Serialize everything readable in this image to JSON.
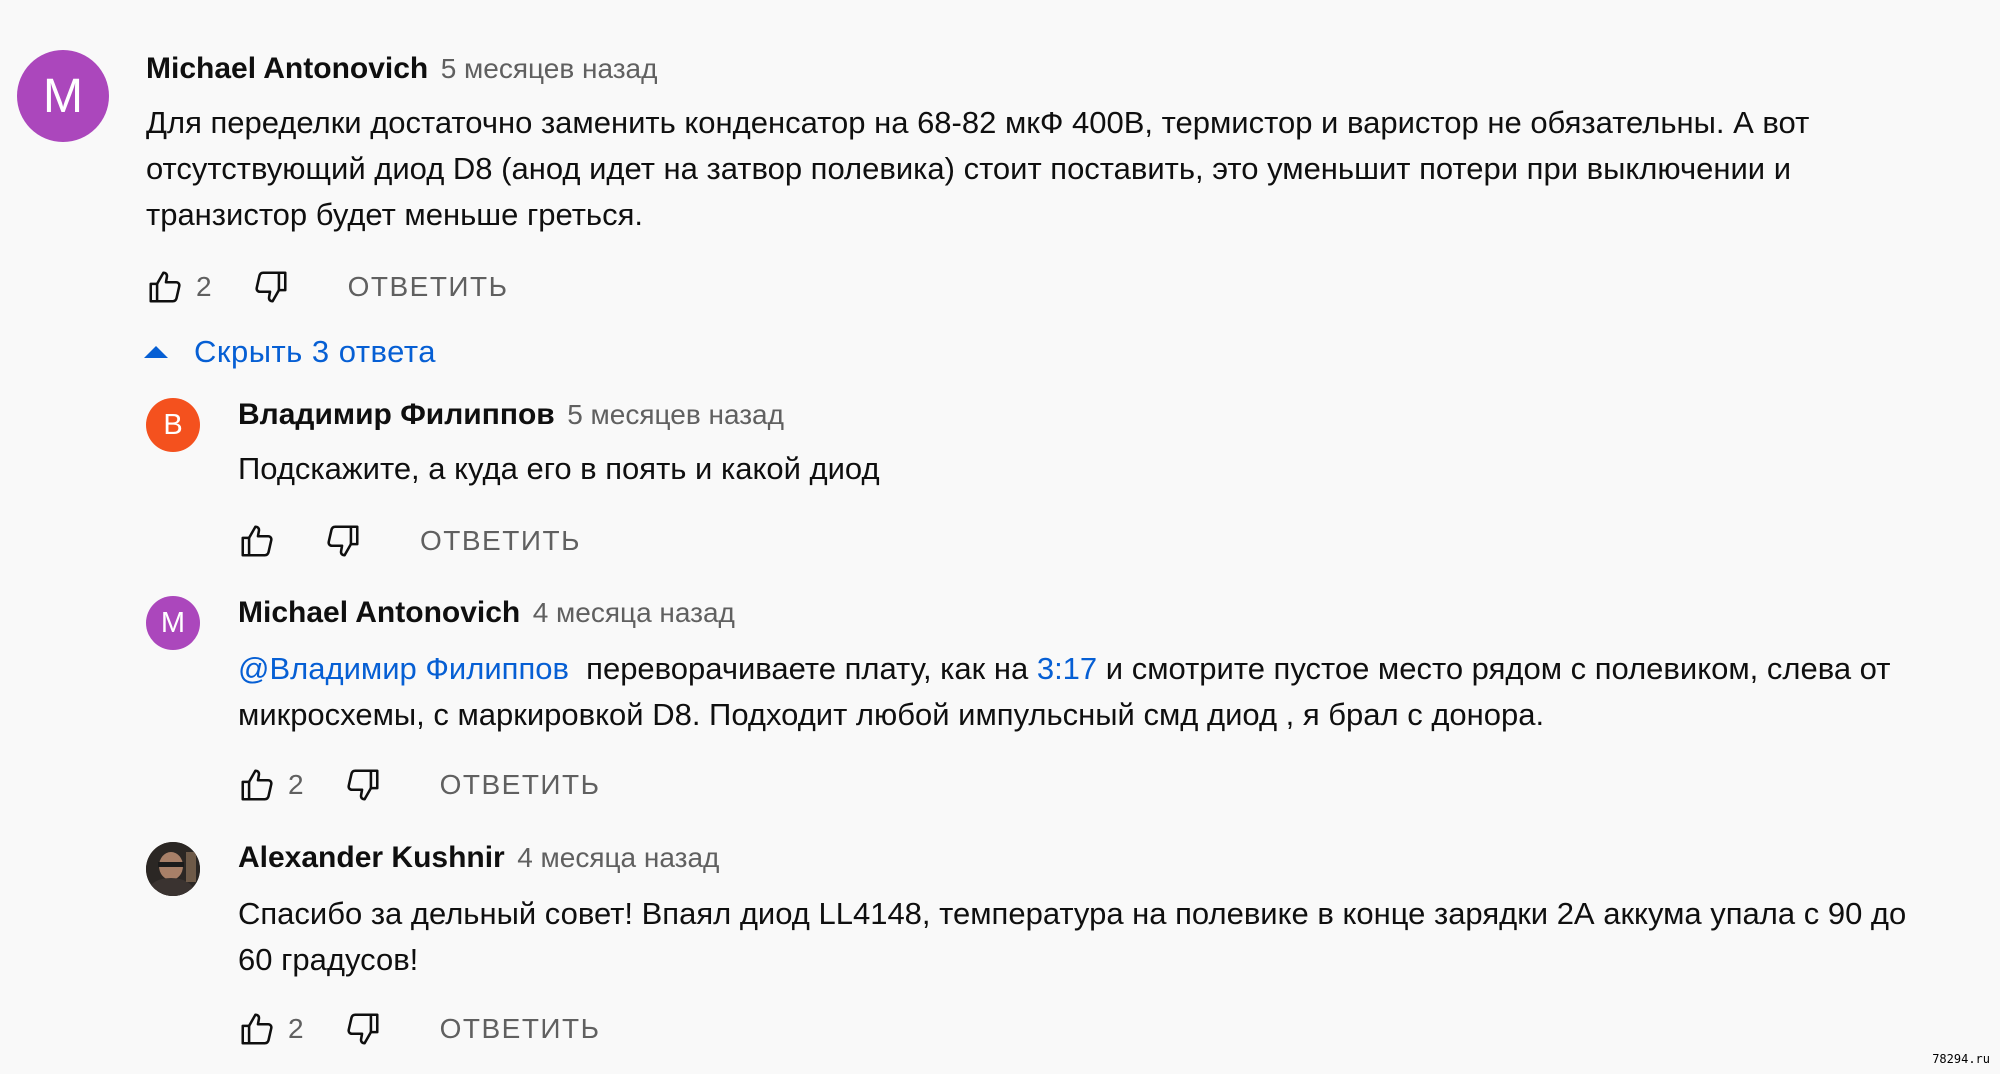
{
  "colors": {
    "background": "#f9f9f9",
    "link": "#065fd4",
    "meta": "#606060",
    "avatar_purple": "#ab47bc",
    "avatar_orange": "#f4511e"
  },
  "icons": {
    "like": "thumb-up-outline-icon",
    "dislike": "thumb-down-outline-icon",
    "collapse": "triangle-up-icon"
  },
  "top_comment": {
    "avatar_letter": "M",
    "author": "Michael Antonovich",
    "time": "5 месяцев назад",
    "text": "Для переделки достаточно заменить конденсатор на 68-82 мкФ 400В, термистор и варистор не обязательны. А вот отсутствующий диод D8 (анод идет на затвор полевика) стоит поставить, это уменьшит потери при выключении и транзистор будет меньше греться.",
    "likes": "2",
    "reply_label": "ОТВЕТИТЬ"
  },
  "replies_toggle": {
    "label": "Скрыть 3 ответа"
  },
  "replies": [
    {
      "avatar_letter": "В",
      "author": "Владимир Филиппов",
      "time": "5 месяцев назад",
      "text": "Подскажите, а куда его в поять и какой диод",
      "likes": "",
      "reply_label": "ОТВЕТИТЬ"
    },
    {
      "avatar_letter": "M",
      "author": "Michael Antonovich",
      "time": "4 месяца назад",
      "mention": "@Владимир Филиппов",
      "text_before": "  переворачиваете плату, как на ",
      "timestamp": "3:17",
      "text_after": " и смотрите пустое место рядом с полевиком, слева от микросхемы, с маркировкой D8. Подходит любой импульсный смд диод , я брал с донора.",
      "likes": "2",
      "reply_label": "ОТВЕТИТЬ"
    },
    {
      "author": "Alexander Kushnir",
      "time": "4 месяца назад",
      "text": "Спасибо за дельный совет! Впаял диод LL4148, температура на полевике в конце зарядки 2А аккума упала с 90 до 60 градусов!",
      "likes": "2",
      "reply_label": "ОТВЕТИТЬ"
    }
  ],
  "watermark": "78294.ru"
}
